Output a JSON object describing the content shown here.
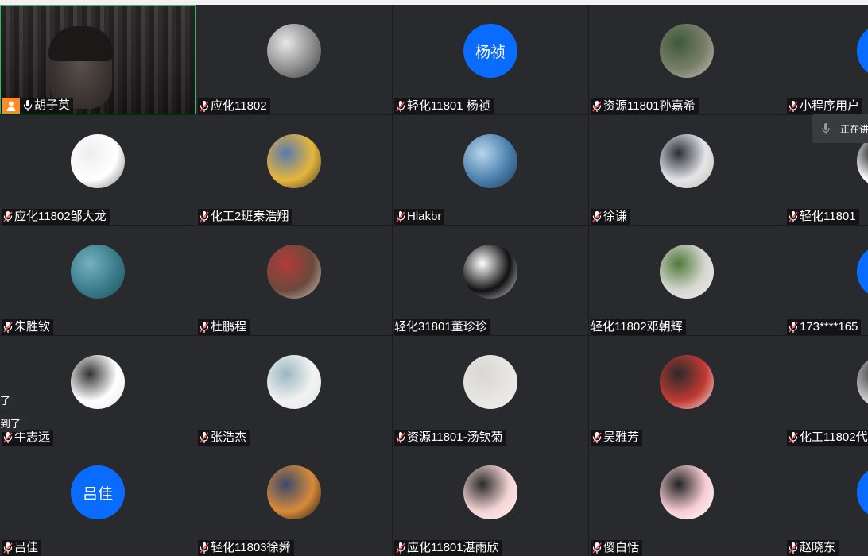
{
  "participants": [
    {
      "name": "胡子英",
      "type": "video",
      "host": true,
      "mic": "on"
    },
    {
      "name": "应化11802",
      "type": "image",
      "mic": "muted",
      "colors": [
        "#8c8c8c",
        "#e8e8e8",
        "#3a3a3a"
      ]
    },
    {
      "name": "轻化11801 杨祯",
      "type": "text",
      "avatar_text": "杨祯",
      "mic": "muted"
    },
    {
      "name": "资源11801孙嘉希",
      "type": "image",
      "mic": "muted",
      "colors": [
        "#7a7f6a",
        "#3e5a3a",
        "#c9c3b5"
      ]
    },
    {
      "name": "小程序用户",
      "type": "text",
      "avatar_text": "",
      "mic": "muted"
    },
    {
      "name": "应化11802邹大龙",
      "type": "image",
      "mic": "muted",
      "colors": [
        "#ffffff",
        "#eeeeee",
        "#777777"
      ]
    },
    {
      "name": "化工2班秦浩翔",
      "type": "image",
      "mic": "muted",
      "colors": [
        "#e6b63a",
        "#5a7ab0",
        "#3b3b3b"
      ]
    },
    {
      "name": "Hlakbr",
      "type": "image",
      "mic": "muted",
      "colors": [
        "#4a7fae",
        "#b7d6ea",
        "#26394d"
      ]
    },
    {
      "name": "徐谦",
      "type": "image",
      "mic": "muted",
      "colors": [
        "#e4e6ea",
        "#2b2e36",
        "#c7b7a8"
      ]
    },
    {
      "name": "轻化11801",
      "type": "image",
      "mic": "muted",
      "colors": [
        "#ffffff",
        "#111111",
        "#dddddd"
      ]
    },
    {
      "name": "朱胜钦",
      "type": "image",
      "mic": "muted",
      "colors": [
        "#3a7b8a",
        "#74b1c0",
        "#1f4f5a"
      ]
    },
    {
      "name": "杜鹏程",
      "type": "image",
      "mic": "muted",
      "colors": [
        "#6b4a3c",
        "#b33a3a",
        "#cfc7c0"
      ]
    },
    {
      "name": "轻化31801董珍珍",
      "type": "image",
      "mic": "none",
      "colors": [
        "#111111",
        "#ffffff",
        "#dddddd"
      ]
    },
    {
      "name": "轻化11802邓朝辉",
      "type": "image",
      "mic": "none",
      "colors": [
        "#d8d8d2",
        "#4f7a3a",
        "#eeeeea"
      ]
    },
    {
      "name": "173****165",
      "type": "text",
      "avatar_text": "",
      "mic": "muted"
    },
    {
      "name": "牛志远",
      "type": "image",
      "mic": "muted",
      "colors": [
        "#ffffff",
        "#333333",
        "#e8e8e8"
      ]
    },
    {
      "name": "张浩杰",
      "type": "image",
      "mic": "muted",
      "colors": [
        "#f2f2f2",
        "#9bb7c0",
        "#e4e4e4"
      ]
    },
    {
      "name": "资源11801-汤钦菊",
      "type": "image",
      "mic": "muted",
      "colors": [
        "#e8e6e4",
        "#d9d6d3",
        "#efedeb"
      ]
    },
    {
      "name": "吴雅芳",
      "type": "image",
      "mic": "muted",
      "colors": [
        "#c23a33",
        "#2a2a2a",
        "#f0f0f0"
      ]
    },
    {
      "name": "化工11802代",
      "type": "image",
      "mic": "muted",
      "colors": [
        "#c9c9c9",
        "#3a3a3a",
        "#f3f3f3"
      ]
    },
    {
      "name": "吕佳",
      "type": "text",
      "avatar_text": "吕佳",
      "mic": "muted"
    },
    {
      "name": "轻化11803徐舜",
      "type": "image",
      "mic": "muted",
      "colors": [
        "#d98a3a",
        "#3a4a6a",
        "#111111"
      ]
    },
    {
      "name": "应化11801湛雨欣",
      "type": "image",
      "mic": "muted",
      "colors": [
        "#f4d4d4",
        "#2a2a2a",
        "#fff5f5"
      ]
    },
    {
      "name": "傻白恬",
      "type": "image",
      "mic": "muted",
      "colors": [
        "#f8cdd4",
        "#222222",
        "#ffffff"
      ]
    },
    {
      "name": "赵晓东",
      "type": "text",
      "avatar_text": "",
      "mic": "muted"
    }
  ],
  "chat_bubbles": [
    "了",
    "到了"
  ],
  "speaking_indicator": {
    "text": "正在讲",
    "icon": "mic-icon"
  },
  "colors": {
    "avatar_blue": "#0a6cff",
    "host_orange": "#ff8a1f",
    "active_border": "#2fbf5a",
    "tile_bg": "#292a2e"
  }
}
